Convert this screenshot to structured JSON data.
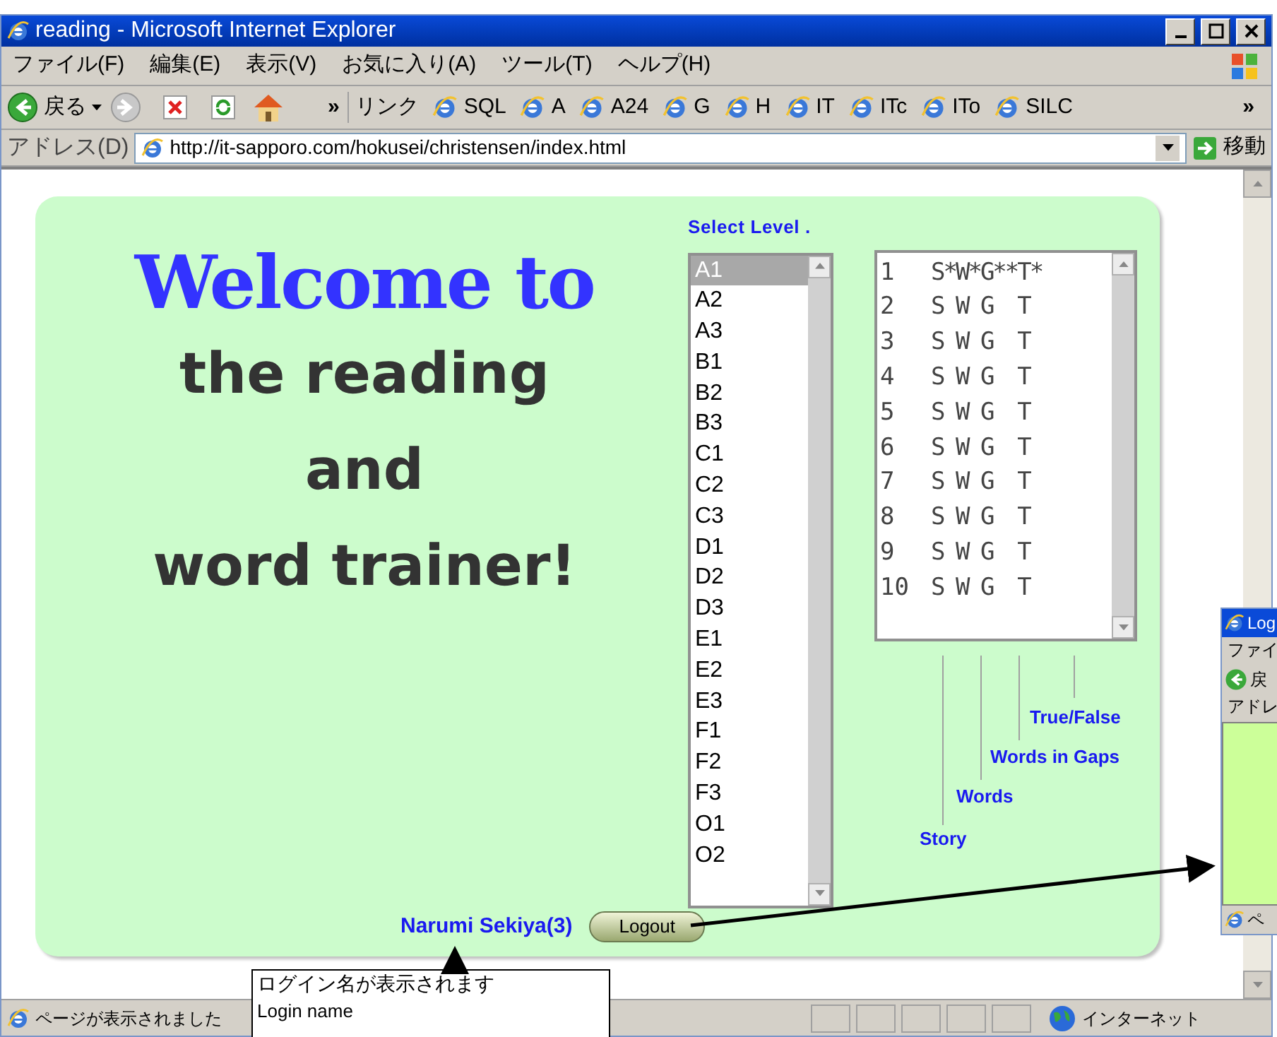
{
  "window": {
    "title": "reading - Microsoft Internet Explorer"
  },
  "menu": [
    "ファイル(F)",
    "編集(E)",
    "表示(V)",
    "お気に入り(A)",
    "ツール(T)",
    "ヘルプ(H)"
  ],
  "toolbar": {
    "back": "戻る",
    "chevron": "»",
    "links_label": "リンク",
    "links": [
      "SQL",
      "A",
      "A24",
      "G",
      "H",
      "IT",
      "ITc",
      "ITo",
      "SILC"
    ],
    "links_chevron": "»"
  },
  "address": {
    "label": "アドレス(D)",
    "url": "http://it-sapporo.com/hokusei/christensen/index.html",
    "go": "移動"
  },
  "page": {
    "heading": "Welcome to",
    "subtitle_lines": [
      "the reading",
      "and",
      "word trainer!"
    ],
    "select_label": "Select Level .",
    "levels": [
      {
        "label": "A1",
        "selected": true
      },
      {
        "label": "A2",
        "selected": false
      },
      {
        "label": "A3",
        "selected": false
      },
      {
        "label": "B1",
        "selected": false
      },
      {
        "label": "B2",
        "selected": false
      },
      {
        "label": "B3",
        "selected": false
      },
      {
        "label": "C1",
        "selected": false
      },
      {
        "label": "C2",
        "selected": false
      },
      {
        "label": "C3",
        "selected": false
      },
      {
        "label": "D1",
        "selected": false
      },
      {
        "label": "D2",
        "selected": false
      },
      {
        "label": "D3",
        "selected": false
      },
      {
        "label": "E1",
        "selected": false
      },
      {
        "label": "E2",
        "selected": false
      },
      {
        "label": "E3",
        "selected": false
      },
      {
        "label": "F1",
        "selected": false
      },
      {
        "label": "F2",
        "selected": false
      },
      {
        "label": "F3",
        "selected": false
      },
      {
        "label": "O1",
        "selected": false
      },
      {
        "label": "O2",
        "selected": false
      }
    ],
    "lessons": [
      {
        "number": "1",
        "marks": "S*W*G**T*"
      },
      {
        "number": "2",
        "marks": "S W G  T"
      },
      {
        "number": "3",
        "marks": "S W G  T"
      },
      {
        "number": "4",
        "marks": "S W G  T"
      },
      {
        "number": "5",
        "marks": "S W G  T"
      },
      {
        "number": "6",
        "marks": "S W G  T"
      },
      {
        "number": "7",
        "marks": "S W G  T"
      },
      {
        "number": "8",
        "marks": "S W G  T"
      },
      {
        "number": "9",
        "marks": "S W G  T"
      },
      {
        "number": "10",
        "marks": "S W G  T"
      }
    ],
    "legend": [
      "True/False",
      "Words in Gaps",
      "Words",
      "Story"
    ],
    "user": "Narumi Sekiya(3)",
    "logout": "Logout"
  },
  "status_bar": {
    "text": "ページが表示されました",
    "zone": "インターネット"
  },
  "popup_window": {
    "title": "Log",
    "menu": "ファイ",
    "back": "戻",
    "address": "アドレ",
    "status": "ペ"
  },
  "callout": {
    "lines": [
      "ログイン名が表示されます",
      "Login name"
    ]
  }
}
